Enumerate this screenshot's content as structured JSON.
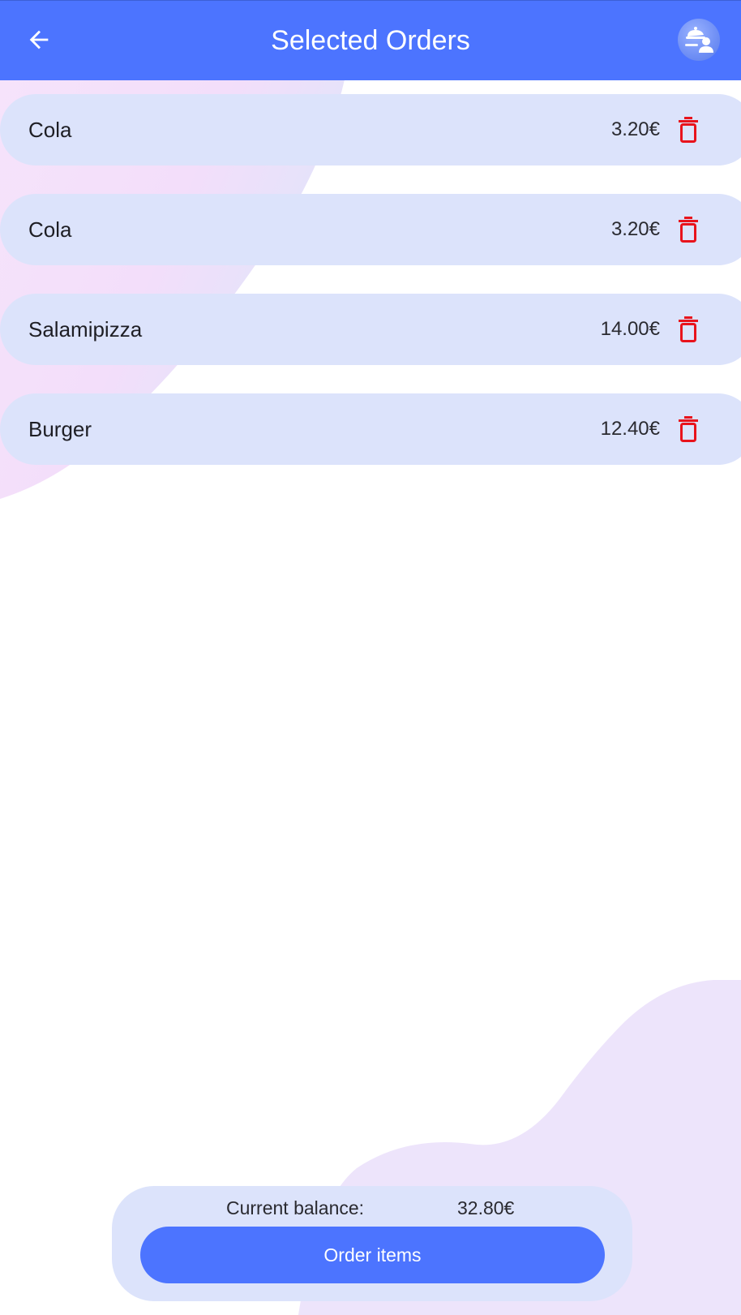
{
  "app_bar": {
    "title": "Selected Orders",
    "back_icon": "arrow-left-icon",
    "profile_icon": "waiter-avatar-icon",
    "background_color": "#4c74ff"
  },
  "orders": [
    {
      "name": "Cola",
      "price": "3.20€"
    },
    {
      "name": "Cola",
      "price": "3.20€"
    },
    {
      "name": "Salamipizza",
      "price": "14.00€"
    },
    {
      "name": "Burger",
      "price": "12.40€"
    }
  ],
  "delete_icon": "trash-icon",
  "delete_icon_color": "#e8131c",
  "footer": {
    "balance_label": "Current balance:",
    "balance_value": "32.80€",
    "order_button_label": "Order items"
  },
  "colors": {
    "accent": "#4c74ff",
    "card": "#dce3fb"
  }
}
